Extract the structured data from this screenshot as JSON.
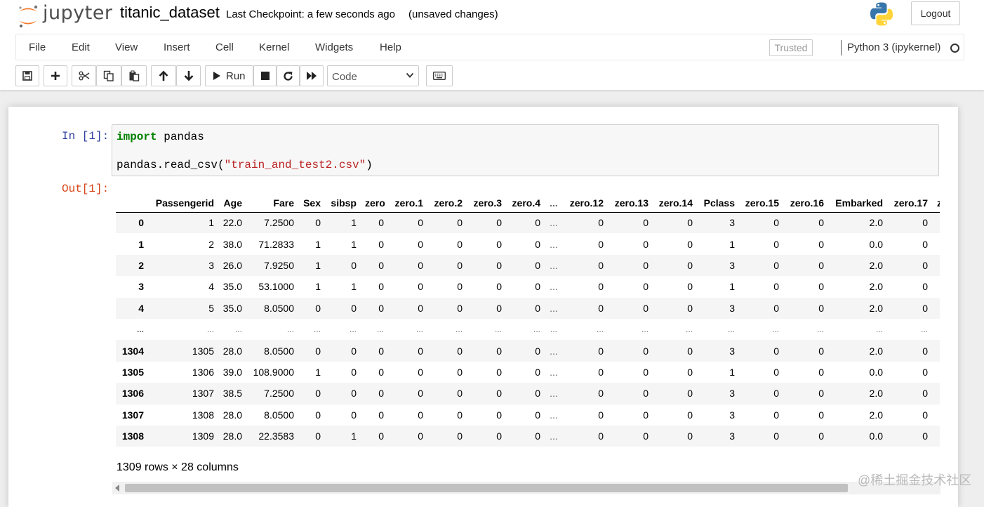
{
  "header": {
    "logo_text": "jupyter",
    "notebook_title": "titanic_dataset",
    "checkpoint": "Last Checkpoint: a few seconds ago",
    "save_status": "(unsaved changes)",
    "logout_label": "Logout"
  },
  "menubar": {
    "items": [
      "File",
      "Edit",
      "View",
      "Insert",
      "Cell",
      "Kernel",
      "Widgets",
      "Help"
    ],
    "trusted_label": "Trusted",
    "kernel_name": "Python 3 (ipykernel)"
  },
  "toolbar": {
    "run_label": "Run",
    "cell_type": "Code"
  },
  "cell": {
    "in_prompt": "In [1]:",
    "code_keyword": "import",
    "code_line1_rest": " pandas",
    "code_line2_prefix": "pandas.read_csv(",
    "code_line2_string": "\"train_and_test2.csv\"",
    "code_line2_suffix": ")",
    "out_prompt": "Out[1]:"
  },
  "dataframe": {
    "columns": [
      "",
      "Passengerid",
      "Age",
      "Fare",
      "Sex",
      "sibsp",
      "zero",
      "zero.1",
      "zero.2",
      "zero.3",
      "zero.4",
      "...",
      "zero.12",
      "zero.13",
      "zero.14",
      "Pclass",
      "zero.15",
      "zero.16",
      "Embarked",
      "zero.17",
      "z"
    ],
    "rows": [
      [
        "0",
        "1",
        "22.0",
        "7.2500",
        "0",
        "1",
        "0",
        "0",
        "0",
        "0",
        "0",
        "...",
        "0",
        "0",
        "0",
        "3",
        "0",
        "0",
        "2.0",
        "0",
        ""
      ],
      [
        "1",
        "2",
        "38.0",
        "71.2833",
        "1",
        "1",
        "0",
        "0",
        "0",
        "0",
        "0",
        "...",
        "0",
        "0",
        "0",
        "1",
        "0",
        "0",
        "0.0",
        "0",
        ""
      ],
      [
        "2",
        "3",
        "26.0",
        "7.9250",
        "1",
        "0",
        "0",
        "0",
        "0",
        "0",
        "0",
        "...",
        "0",
        "0",
        "0",
        "3",
        "0",
        "0",
        "2.0",
        "0",
        ""
      ],
      [
        "3",
        "4",
        "35.0",
        "53.1000",
        "1",
        "1",
        "0",
        "0",
        "0",
        "0",
        "0",
        "...",
        "0",
        "0",
        "0",
        "1",
        "0",
        "0",
        "2.0",
        "0",
        ""
      ],
      [
        "4",
        "5",
        "35.0",
        "8.0500",
        "0",
        "0",
        "0",
        "0",
        "0",
        "0",
        "0",
        "...",
        "0",
        "0",
        "0",
        "3",
        "0",
        "0",
        "2.0",
        "0",
        ""
      ],
      [
        "...",
        "...",
        "...",
        "...",
        "...",
        "...",
        "...",
        "...",
        "...",
        "...",
        "...",
        "...",
        "...",
        "...",
        "...",
        "...",
        "...",
        "...",
        "...",
        "...",
        ""
      ],
      [
        "1304",
        "1305",
        "28.0",
        "8.0500",
        "0",
        "0",
        "0",
        "0",
        "0",
        "0",
        "0",
        "...",
        "0",
        "0",
        "0",
        "3",
        "0",
        "0",
        "2.0",
        "0",
        ""
      ],
      [
        "1305",
        "1306",
        "39.0",
        "108.9000",
        "1",
        "0",
        "0",
        "0",
        "0",
        "0",
        "0",
        "...",
        "0",
        "0",
        "0",
        "1",
        "0",
        "0",
        "0.0",
        "0",
        ""
      ],
      [
        "1306",
        "1307",
        "38.5",
        "7.2500",
        "0",
        "0",
        "0",
        "0",
        "0",
        "0",
        "0",
        "...",
        "0",
        "0",
        "0",
        "3",
        "0",
        "0",
        "2.0",
        "0",
        ""
      ],
      [
        "1307",
        "1308",
        "28.0",
        "8.0500",
        "0",
        "0",
        "0",
        "0",
        "0",
        "0",
        "0",
        "...",
        "0",
        "0",
        "0",
        "3",
        "0",
        "0",
        "2.0",
        "0",
        ""
      ],
      [
        "1308",
        "1309",
        "28.0",
        "22.3583",
        "0",
        "1",
        "0",
        "0",
        "0",
        "0",
        "0",
        "...",
        "0",
        "0",
        "0",
        "3",
        "0",
        "0",
        "0.0",
        "0",
        ""
      ]
    ],
    "shape_text": "1309 rows × 28 columns"
  },
  "watermark": "@稀土掘金技术社区",
  "colors": {
    "in_prompt": "#303f9f",
    "out_prompt": "#d84315",
    "keyword": "#008000",
    "string": "#ba2121",
    "jupyter_orange": "#f37726"
  },
  "icons": [
    "save-icon",
    "plus-icon",
    "cut-icon",
    "copy-icon",
    "paste-icon",
    "arrow-up-icon",
    "arrow-down-icon",
    "play-icon",
    "stop-icon",
    "restart-icon",
    "fast-forward-icon",
    "keyboard-icon",
    "python-logo-icon",
    "jupyter-logo-icon",
    "kernel-idle-icon"
  ]
}
